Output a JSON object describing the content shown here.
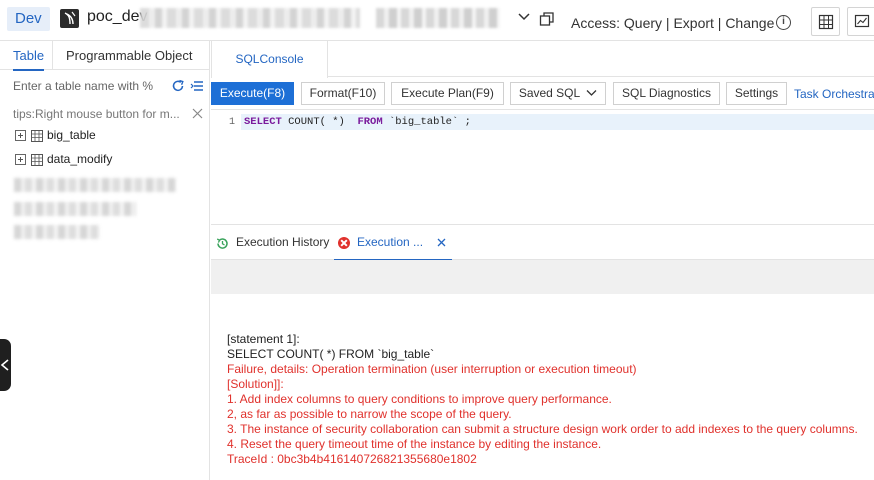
{
  "header": {
    "env": "Dev",
    "db_name": "poc_dev",
    "access_label": "Access:",
    "access_value": "Query | Export | Change"
  },
  "left_panel": {
    "tabs": [
      "Table",
      "Programmable Object"
    ],
    "search_placeholder": "Enter a table name with %",
    "tips": "tips:Right mouse button for m...",
    "tables": [
      "big_table",
      "data_modify"
    ]
  },
  "sql_console": {
    "tab_label": "SQLConsole",
    "toolbar": {
      "execute": "Execute(F8)",
      "format": "Format(F10)",
      "execute_plan": "Execute Plan(F9)",
      "saved_sql": "Saved SQL",
      "sql_diagnostics": "SQL Diagnostics",
      "settings": "Settings",
      "task_orchestration": "Task Orchestrat"
    },
    "editor": {
      "line_number": "1",
      "kw_select": "SELECT",
      "fn_count": " COUNT( *)  ",
      "kw_from": "FROM",
      "table_ref": " `big_table` ;"
    }
  },
  "results": {
    "tabs": [
      "Execution History",
      "Execution ..."
    ],
    "messages": [
      {
        "text": "[statement 1]:",
        "color": "#222222"
      },
      {
        "text": "SELECT COUNT( *) FROM `big_table`",
        "color": "#222222"
      },
      {
        "text": "Failure, details: Operation termination (user interruption or execution timeout)",
        "color": "#e0312c"
      },
      {
        "text": "[Solution]]:",
        "color": "#e0312c"
      },
      {
        "text": "1. Add index columns to query conditions to improve query performance.",
        "color": "#e0312c"
      },
      {
        "text": "2, as far as possible to narrow the scope of the query.",
        "color": "#e0312c"
      },
      {
        "text": "3. The instance of security collaboration can submit a structure design work order to add indexes to the query columns.",
        "color": "#e0312c"
      },
      {
        "text": "4. Reset the query timeout time of the instance by editing the instance.",
        "color": "#e0312c"
      },
      {
        "text": "TraceId : 0bc3b4b416140726821355680e1802",
        "color": "#e0312c"
      }
    ]
  },
  "colors": {
    "accent": "#2466c2",
    "primary_button": "#1d6fd6",
    "error": "#e0312c"
  }
}
